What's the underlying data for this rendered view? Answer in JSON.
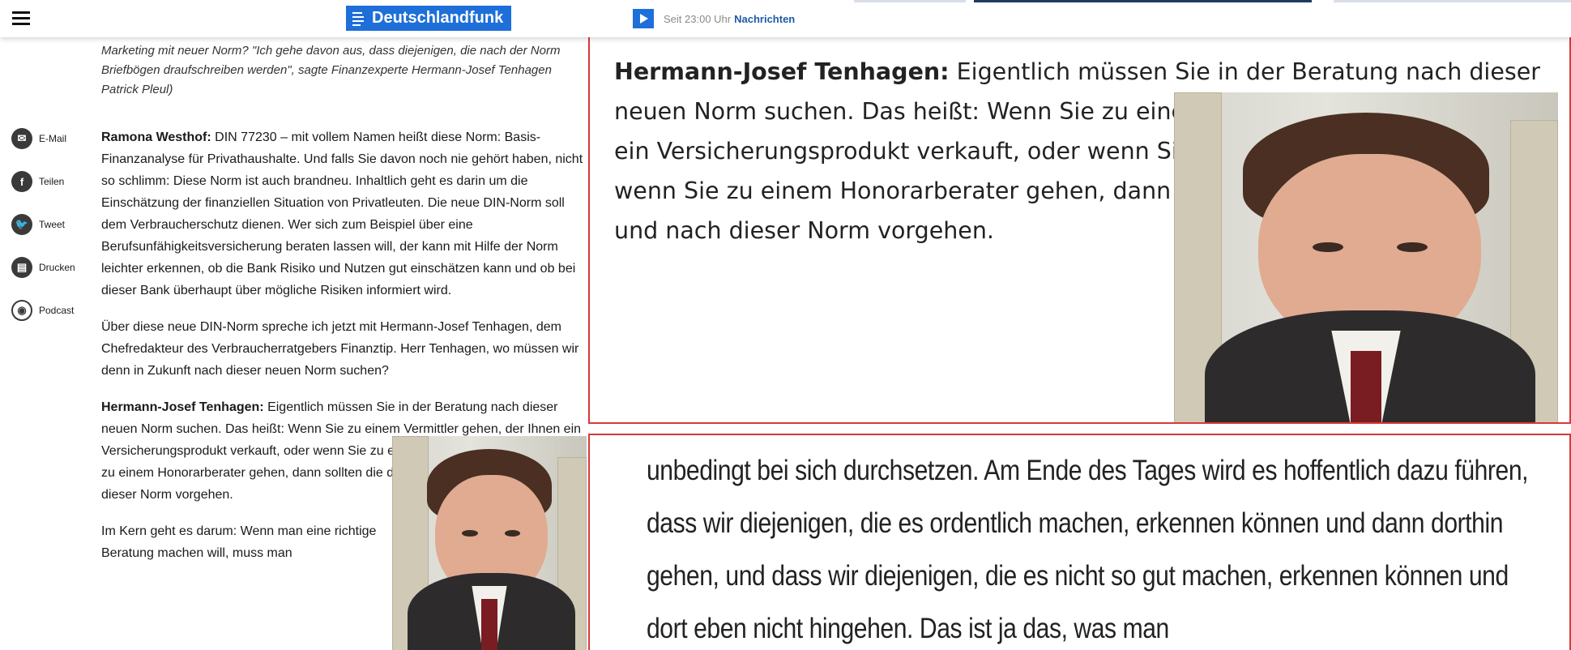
{
  "header": {
    "brand": "Deutschlandfunk",
    "radio_time": "Seit 23:00 Uhr",
    "radio_title": "Nachrichten"
  },
  "sidebar": {
    "items": [
      {
        "label": "E-Mail",
        "icon": "email-icon"
      },
      {
        "label": "Teilen",
        "icon": "facebook-icon"
      },
      {
        "label": "Tweet",
        "icon": "twitter-icon"
      },
      {
        "label": "Drucken",
        "icon": "print-icon"
      },
      {
        "label": "Podcast",
        "icon": "podcast-icon"
      }
    ]
  },
  "article": {
    "caption": "Marketing mit neuer Norm? \"Ich gehe davon aus, dass diejenigen, die nach der Norm Briefbögen draufschreiben werden\", sagte Finanzexperte Hermann-Josef Tenhagen Patrick Pleul)",
    "p1_speaker": "Ramona Westhof:",
    "p1_text": " DIN 77230 – mit vollem Namen heißt diese Norm: Basis-Finanzanalyse für Privathaushalte. Und falls Sie davon noch nie gehört haben, nicht so schlimm: Diese Norm ist auch brandneu. Inhaltlich geht es darin um die Einschätzung der finanziellen Situation von Privatleuten. Die neue DIN-Norm soll dem Verbraucherschutz dienen. Wer sich zum Beispiel über eine Berufsunfähigkeitsversicherung beraten lassen will, der kann mit Hilfe der Norm leichter erkennen, ob die Bank Risiko und Nutzen gut einschätzen kann und ob bei dieser Bank überhaupt über mögliche Risiken informiert wird.",
    "p2_text": "Über diese neue DIN-Norm spreche ich jetzt mit Hermann-Josef Tenhagen, dem Chefredakteur des Verbraucherratgebers Finanztip. Herr Tenhagen, wo müssen wir denn in Zukunft nach dieser neuen Norm suchen?",
    "p3_speaker": "Hermann-Josef Tenhagen:",
    "p3_text": " Eigentlich müssen Sie in der Beratung nach dieser neuen Norm suchen. Das heißt: Wenn Sie zu einem Vermittler gehen, der Ihnen ein Versicherungsprodukt verkauft, oder wenn Sie zu einer Bank gehen, oder wenn Sie zu einem Honorarberater gehen, dann sollten die diese Norm kennen und nach dieser Norm vorgehen.",
    "p4_text": "Im Kern geht es darum: Wenn man eine richtige Beratung machen will, muss man"
  },
  "zoom1": {
    "speaker": "Hermann-Josef Tenhagen:",
    "text": " Eigentlich müssen Sie in der Beratung nach dieser neuen Norm suchen. Das heißt: Wenn Sie zu einem Vermittler gehen, der Ihnen ein Versicherungsprodukt verkauft, oder wenn Sie zu einer Bank gehen, oder wenn Sie zu einem Honorarberater gehen, dann sollten die diese Norm kennen und nach dieser Norm vorgehen."
  },
  "zoom2": {
    "text": "unbedingt bei sich durchsetzen. Am Ende des Tages wird es hoffentlich dazu führen, dass wir diejenigen, die es ordentlich machen, erkennen können und dann dorthin gehen, und dass wir diejenigen, die es nicht so gut machen, erkennen können und dort eben nicht hingehen. Das ist ja das, was man"
  },
  "colors": {
    "brand_blue": "#1e6fd9",
    "link_blue": "#1e5aa8",
    "zoom_border": "#d63a3a"
  }
}
